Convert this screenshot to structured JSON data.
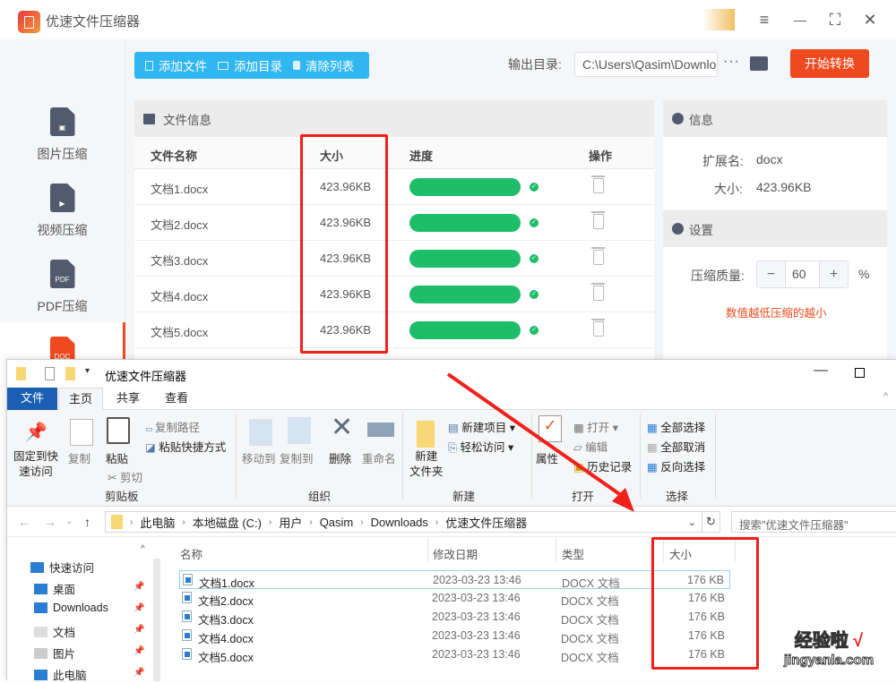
{
  "app": {
    "title": "优速文件压缩器",
    "window_controls": {
      "menu": "≡",
      "minimize": "—",
      "maximize": "⛶",
      "close": "✕"
    },
    "sidebar": [
      {
        "label": "图片压缩",
        "icon": "image-file-icon",
        "glyph": "▣"
      },
      {
        "label": "视频压缩",
        "icon": "video-file-icon",
        "glyph": "▶"
      },
      {
        "label": "PDF压缩",
        "icon": "pdf-file-icon",
        "glyph": "PDF"
      },
      {
        "label": "",
        "icon": "doc-file-icon",
        "glyph": "DOC",
        "active": true
      }
    ],
    "toolbar": {
      "add_file": "添加文件",
      "add_folder": "添加目录",
      "clear_list": "清除列表"
    },
    "output": {
      "label": "输出目录:",
      "path": "C:\\Users\\Qasim\\Downloads",
      "more": "···"
    },
    "start_button": "开始转换",
    "files_panel": {
      "title": "文件信息",
      "columns": {
        "name": "文件名称",
        "size": "大小",
        "progress": "进度",
        "action": "操作"
      },
      "rows": [
        {
          "name": "文档1.docx",
          "size": "423.96KB",
          "progress": 1.0,
          "status": "done"
        },
        {
          "name": "文档2.docx",
          "size": "423.96KB",
          "progress": 1.0,
          "status": "done"
        },
        {
          "name": "文档3.docx",
          "size": "423.96KB",
          "progress": 1.0,
          "status": "done"
        },
        {
          "name": "文档4.docx",
          "size": "423.96KB",
          "progress": 1.0,
          "status": "done"
        },
        {
          "name": "文档5.docx",
          "size": "423.96KB",
          "progress": 1.0,
          "status": "done"
        }
      ]
    },
    "info_panel": {
      "title": "信息",
      "ext_label": "扩展名:",
      "ext_value": "docx",
      "size_label": "大小:",
      "size_value": "423.96KB"
    },
    "settings_panel": {
      "title": "设置",
      "quality_label": "压缩质量:",
      "quality_value": "60",
      "minus": "−",
      "plus": "+",
      "unit": "%",
      "hint": "数值越低压缩的越小"
    },
    "colors": {
      "accent_blue": "#30b7f2",
      "accent_red": "#ef4a1f",
      "progress_green": "#1dbd6a"
    }
  },
  "explorer": {
    "title": "优速文件压缩器",
    "tabs": [
      "文件",
      "主页",
      "共享",
      "查看"
    ],
    "ribbon": {
      "clipboard": {
        "group": "剪贴板",
        "pin": "固定到快\n速访问",
        "pin_l1": "固定到快",
        "pin_l2": "速访问",
        "copy": "复制",
        "paste": "粘贴",
        "copy_path": "复制路径",
        "paste_shortcut": "粘贴快捷方式",
        "cut": "剪切"
      },
      "organize": {
        "group": "组织",
        "move_to": "移动到",
        "copy_to": "复制到",
        "delete": "删除",
        "rename": "重命名"
      },
      "new": {
        "group": "新建",
        "new_folder_l1": "新建",
        "new_folder_l2": "文件夹",
        "new_item": "新建项目",
        "easy_access": "轻松访问"
      },
      "open": {
        "group": "打开",
        "properties": "属性",
        "open": "打开",
        "edit": "编辑",
        "history": "历史记录"
      },
      "select": {
        "group": "选择",
        "select_all": "全部选择",
        "select_none": "全部取消",
        "invert": "反向选择"
      }
    },
    "breadcrumb": [
      "此电脑",
      "本地磁盘 (C:)",
      "用户",
      "Qasim",
      "Downloads",
      "优速文件压缩器"
    ],
    "search_placeholder": "搜索\"优速文件压缩器\"",
    "nav": [
      {
        "label": "快速访问",
        "pinned": false
      },
      {
        "label": "桌面",
        "pinned": true
      },
      {
        "label": "Downloads",
        "pinned": true
      },
      {
        "label": "文档",
        "pinned": true
      },
      {
        "label": "图片",
        "pinned": true
      },
      {
        "label": "此电脑",
        "pinned": true
      }
    ],
    "columns": {
      "name": "名称",
      "modified": "修改日期",
      "type": "类型",
      "size": "大小"
    },
    "files": [
      {
        "name": "文档1.docx",
        "modified": "2023-03-23 13:46",
        "type": "DOCX 文档",
        "size": "176 KB"
      },
      {
        "name": "文档2.docx",
        "modified": "2023-03-23 13:46",
        "type": "DOCX 文档",
        "size": "176 KB"
      },
      {
        "name": "文档3.docx",
        "modified": "2023-03-23 13:46",
        "type": "DOCX 文档",
        "size": "176 KB"
      },
      {
        "name": "文档4.docx",
        "modified": "2023-03-23 13:46",
        "type": "DOCX 文档",
        "size": "176 KB"
      },
      {
        "name": "文档5.docx",
        "modified": "2023-03-23 13:46",
        "type": "DOCX 文档",
        "size": "176 KB"
      }
    ]
  },
  "watermark": {
    "text": "经验啦",
    "check": "√",
    "domain": "jingyanla.com"
  }
}
